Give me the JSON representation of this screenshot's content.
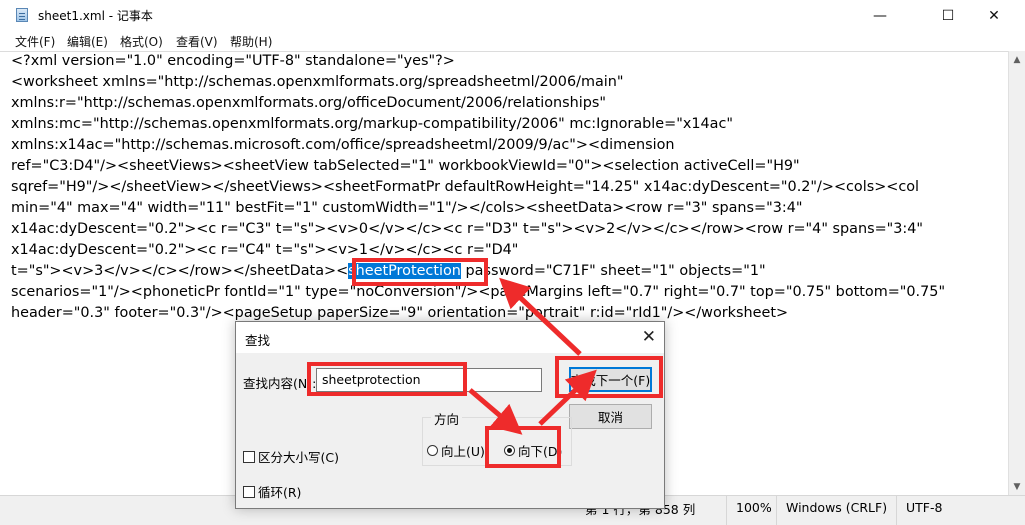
{
  "window": {
    "title": "sheet1.xml - 记事本",
    "minimize_glyph": "—",
    "maximize_glyph": "☐",
    "close_glyph": "✕"
  },
  "menu": {
    "items": [
      "文件(F)",
      "编辑(E)",
      "格式(O)",
      "查看(V)",
      "帮助(H)"
    ]
  },
  "editor": {
    "lines": [
      "<?xml version=\"1.0\" encoding=\"UTF-8\" standalone=\"yes\"?>",
      "<worksheet xmlns=\"http://schemas.openxmlformats.org/spreadsheetml/2006/main\"",
      "xmlns:r=\"http://schemas.openxmlformats.org/officeDocument/2006/relationships\"",
      "xmlns:mc=\"http://schemas.openxmlformats.org/markup-compatibility/2006\" mc:Ignorable=\"x14ac\"",
      "xmlns:x14ac=\"http://schemas.microsoft.com/office/spreadsheetml/2009/9/ac\"><dimension",
      "ref=\"C3:D4\"/><sheetViews><sheetView tabSelected=\"1\" workbookViewId=\"0\"><selection activeCell=\"H9\"",
      "sqref=\"H9\"/></sheetView></sheetViews><sheetFormatPr defaultRowHeight=\"14.25\" x14ac:dyDescent=\"0.2\"/><cols><col",
      "min=\"4\" max=\"4\" width=\"11\" bestFit=\"1\" customWidth=\"1\"/></cols><sheetData><row r=\"3\" spans=\"3:4\"",
      "x14ac:dyDescent=\"0.2\"><c r=\"C3\" t=\"s\"><v>0</v></c><c r=\"D3\" t=\"s\"><v>2</v></c></row><row r=\"4\" spans=\"3:4\"",
      "x14ac:dyDescent=\"0.2\"><c r=\"C4\" t=\"s\"><v>1</v></c><c r=\"D4\""
    ],
    "line11_before": "t=\"s\"><v>3</v></c></row></sheetData><",
    "line11_highlight": "sheetProtection",
    "line11_after": " password=\"C71F\" sheet=\"1\" objects=\"1\"",
    "lines_tail": [
      "scenarios=\"1\"/><phoneticPr fontId=\"1\" type=\"noConversion\"/><pageMargins left=\"0.7\" right=\"0.7\" top=\"0.75\" bottom=\"0.75\"",
      "header=\"0.3\" footer=\"0.3\"/><pageSetup paperSize=\"9\" orientation=\"portrait\" r:id=\"rId1\"/></worksheet>"
    ],
    "highlight_color": "#0078d7"
  },
  "statusbar": {
    "position": "第 1 行，第 858 列",
    "zoom": "100%",
    "line_ending": "Windows (CRLF)",
    "encoding": "UTF-8"
  },
  "find_dialog": {
    "title": "查找",
    "close_glyph": "✕",
    "find_label": "查找内容(N):",
    "find_value": "sheetprotection",
    "find_next_button": "查找下一个(F)",
    "cancel_button": "取消",
    "direction_label": "方向",
    "direction_up": "向上(U)",
    "direction_down": "向下(D)",
    "direction_selected": "down",
    "match_case_label": "区分大小写(C)",
    "wrap_label": "循环(R)"
  },
  "annotation": {
    "color": "#ee2b2b"
  }
}
